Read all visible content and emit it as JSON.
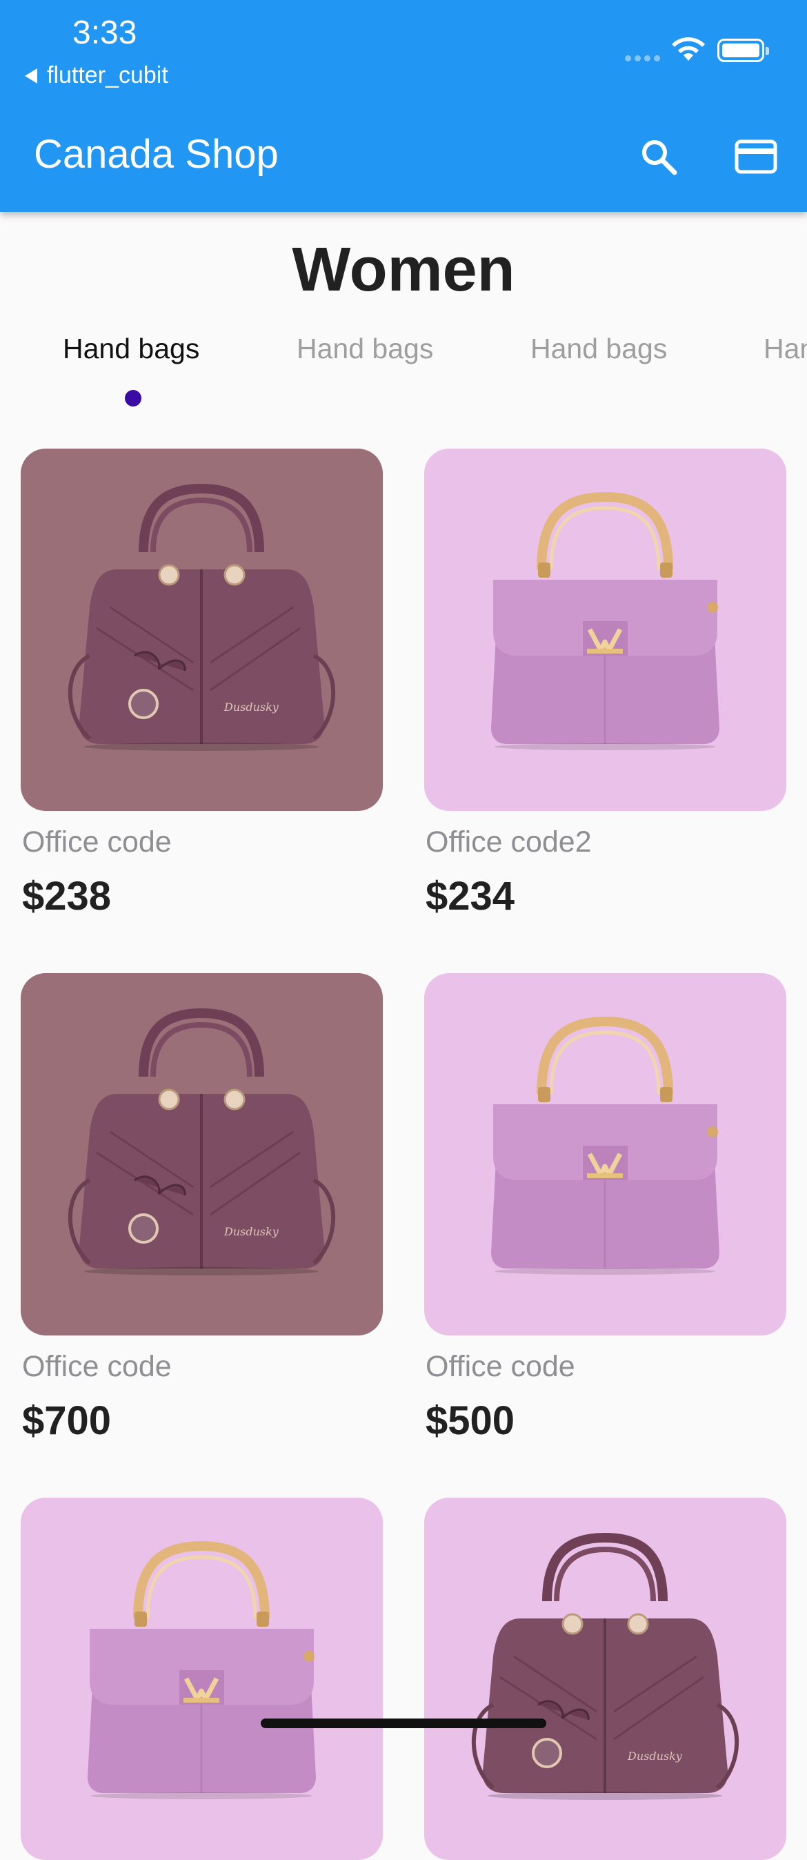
{
  "status_bar": {
    "time": "3:33",
    "back_app": "flutter_cubit"
  },
  "app_bar": {
    "title": "Canada Shop",
    "background_color": "#2196f3",
    "actions": [
      {
        "icon": "search-icon"
      },
      {
        "icon": "credit-card-icon"
      }
    ]
  },
  "section": {
    "title": "Women"
  },
  "tabs": [
    {
      "label": "Hand bags",
      "active": true
    },
    {
      "label": "Hand bags",
      "active": false
    },
    {
      "label": "Hand bags",
      "active": false
    },
    {
      "label": "Hand bags",
      "active": false
    }
  ],
  "tab_indicator_color": "#3a0ca3",
  "products": [
    {
      "name": "Office code",
      "price": "$238",
      "bg_color": "#9b6f78",
      "bag": "plum-tote"
    },
    {
      "name": "Office code2",
      "price": "$234",
      "bg_color": "#eac1e8",
      "bag": "lilac-flap"
    },
    {
      "name": "Office code",
      "price": "$700",
      "bg_color": "#9b6f78",
      "bag": "plum-tote"
    },
    {
      "name": "Office code",
      "price": "$500",
      "bg_color": "#eac1e8",
      "bag": "lilac-flap"
    },
    {
      "name": "",
      "price": "",
      "bg_color": "#eac1e8",
      "bag": "lilac-flap"
    },
    {
      "name": "",
      "price": "",
      "bg_color": "#eac1e8",
      "bag": "plum-tote"
    }
  ]
}
